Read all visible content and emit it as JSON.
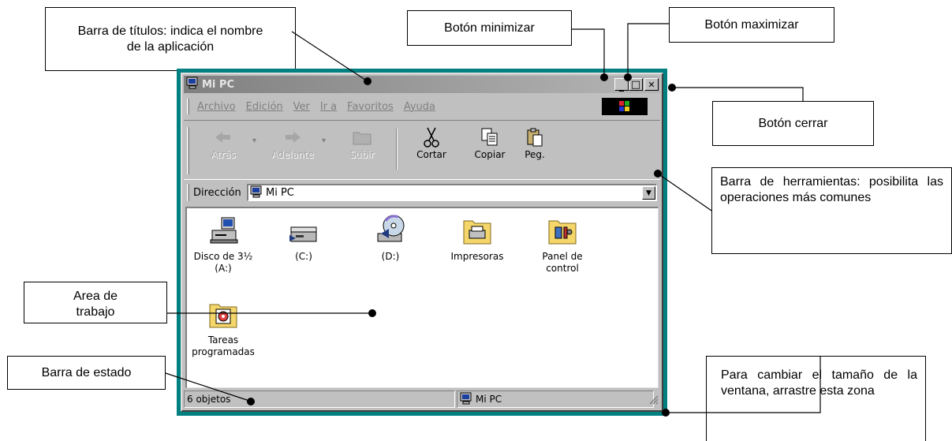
{
  "window": {
    "title": "Mi PC",
    "minimize_label": "_",
    "maximize_label": "□",
    "close_label": "✕",
    "frame_color": "#008080"
  },
  "menu": {
    "items": [
      "Archivo",
      "Edición",
      "Ver",
      "Ir a",
      "Favoritos",
      "Ayuda"
    ]
  },
  "toolbar": {
    "back": "Atrás",
    "forward": "Adelante",
    "up": "Subir",
    "cut": "Cortar",
    "copy": "Copiar",
    "paste": "Peg."
  },
  "address": {
    "label": "Dirección",
    "value": "Mi PC"
  },
  "items": [
    {
      "label": "Disco de 3½ (A:)",
      "icon": "floppy-drive-icon"
    },
    {
      "label": "(C:)",
      "icon": "hard-drive-icon"
    },
    {
      "label": "(D:)",
      "icon": "cd-drive-icon"
    },
    {
      "label": "Impresoras",
      "icon": "printers-folder-icon"
    },
    {
      "label": "Panel de control",
      "icon": "control-panel-icon"
    },
    {
      "label": "Tareas programadas",
      "icon": "scheduled-tasks-icon"
    }
  ],
  "status": {
    "count": "6 objetos",
    "location": "Mi PC"
  },
  "callouts": {
    "title_bar": "Barra de títulos: indica el nombre de la aplicación",
    "minimize": "Botón minimizar",
    "maximize": "Botón maximizar",
    "close": "Botón cerrar",
    "toolbar": "Barra de herramientas: posibilita las operaciones más comunes",
    "work_area": "Area de trabajo",
    "status_bar": "Barra de estado",
    "resize": "Para cambiar el tamaño de la ventana, arrastre esta zona"
  }
}
